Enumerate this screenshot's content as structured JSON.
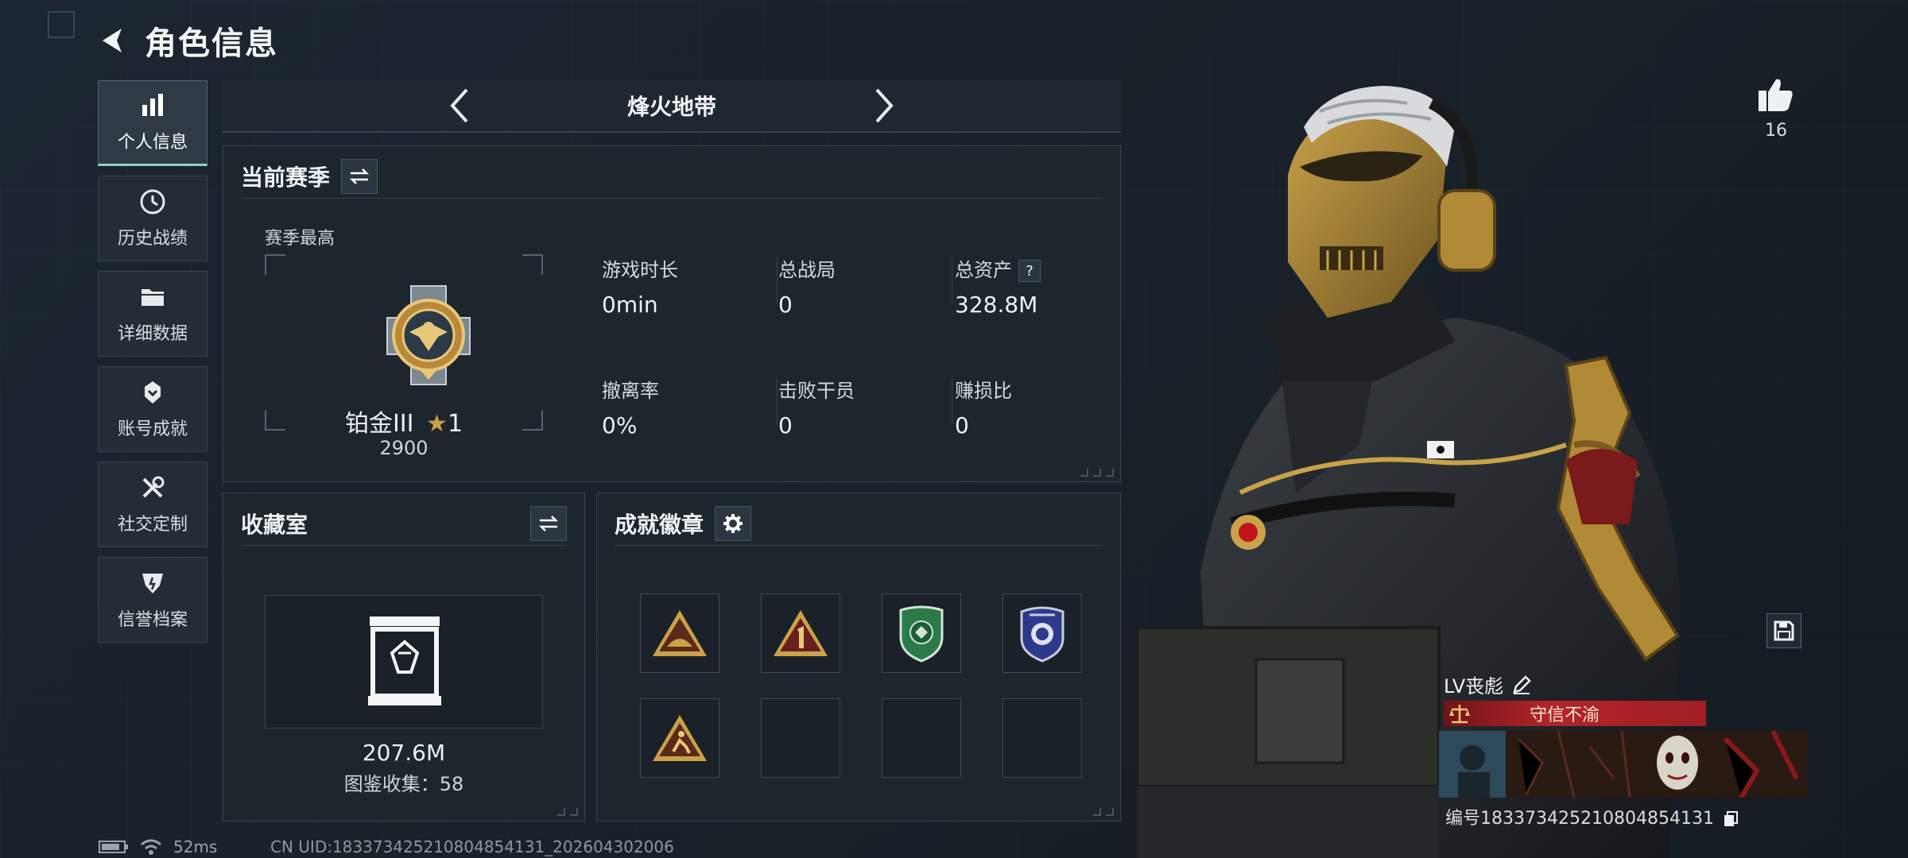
{
  "header": {
    "title": "角色信息"
  },
  "sidebar": {
    "items": [
      {
        "label": "个人信息",
        "icon": "bar-chart-icon",
        "active": true
      },
      {
        "label": "历史战绩",
        "icon": "clock-icon"
      },
      {
        "label": "详细数据",
        "icon": "folder-icon"
      },
      {
        "label": "账号成就",
        "icon": "badge-icon"
      },
      {
        "label": "社交定制",
        "icon": "wrench-icon"
      },
      {
        "label": "信誉档案",
        "icon": "shield-icon"
      }
    ]
  },
  "mode": {
    "title": "烽火地带"
  },
  "season": {
    "title": "当前赛季",
    "best_label": "赛季最高",
    "rank_name": "铂金III",
    "rank_stars": "1",
    "rank_score": "2900",
    "stats": [
      {
        "label": "游戏时长",
        "value": "0min"
      },
      {
        "label": "总战局",
        "value": "0"
      },
      {
        "label": "总资产",
        "value": "328.8M",
        "help": "?"
      },
      {
        "label": "撤离率",
        "value": "0%"
      },
      {
        "label": "击败干员",
        "value": "0"
      },
      {
        "label": "赚损比",
        "value": "0"
      }
    ]
  },
  "collection": {
    "title": "收藏室",
    "value": "207.6M",
    "count_text": "图鉴收集：58"
  },
  "achievements": {
    "title": "成就徽章",
    "slots_filled": 5,
    "slots_total": 8
  },
  "profile": {
    "likes": "16",
    "player_name": "LV丧彪",
    "title_text": "守信不渝",
    "player_id": "编号1833734252108048541​31"
  },
  "footer": {
    "ping": "52ms",
    "uid": "CN UID:18337342521080485​4131_202604302006"
  },
  "colors": {
    "accent": "#8fd3c0",
    "gold": "#c9a24a",
    "title_red": "#b2242a"
  }
}
